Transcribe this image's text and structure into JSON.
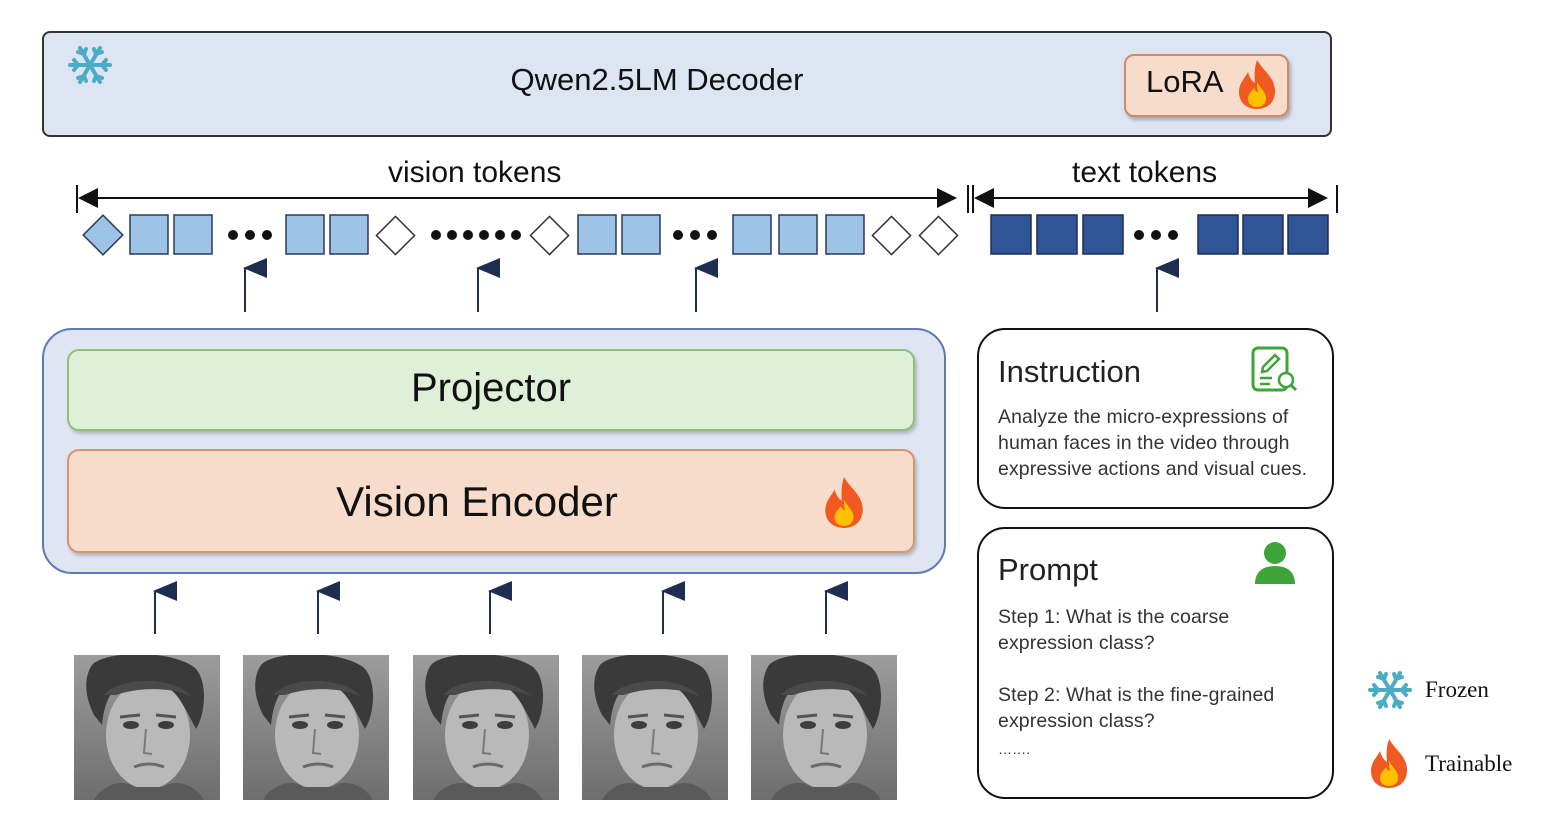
{
  "decoder": {
    "title": "Qwen2.5LM Decoder",
    "adapter_label": "LoRA"
  },
  "tokens": {
    "vision_label": "vision tokens",
    "text_label": "text tokens"
  },
  "vision_module": {
    "projector_label": "Projector",
    "encoder_label": "Vision Encoder"
  },
  "instruction": {
    "title": "Instruction",
    "lines": [
      "Analyze the micro-expressions of",
      "human faces in the video through",
      "expressive actions and visual cues."
    ]
  },
  "prompt": {
    "title": "Prompt",
    "step1": [
      "Step 1:  What is the coarse",
      "expression class?"
    ],
    "step2": [
      "Step 2:  What is the fine-grained",
      "expression class?"
    ],
    "ellipsis": "……."
  },
  "legend": {
    "frozen": "Frozen",
    "trainable": "Trainable"
  },
  "icons": [
    "snowflake-icon",
    "flame-icon",
    "document-search-icon",
    "user-icon"
  ],
  "colors": {
    "light_token": "#9dc3e6",
    "dark_token": "#2f5597",
    "frozen": "#4bacc6",
    "flame_outer": "#f05a22",
    "flame_inner": "#ffc000",
    "icon_green": "#3ea43a"
  }
}
